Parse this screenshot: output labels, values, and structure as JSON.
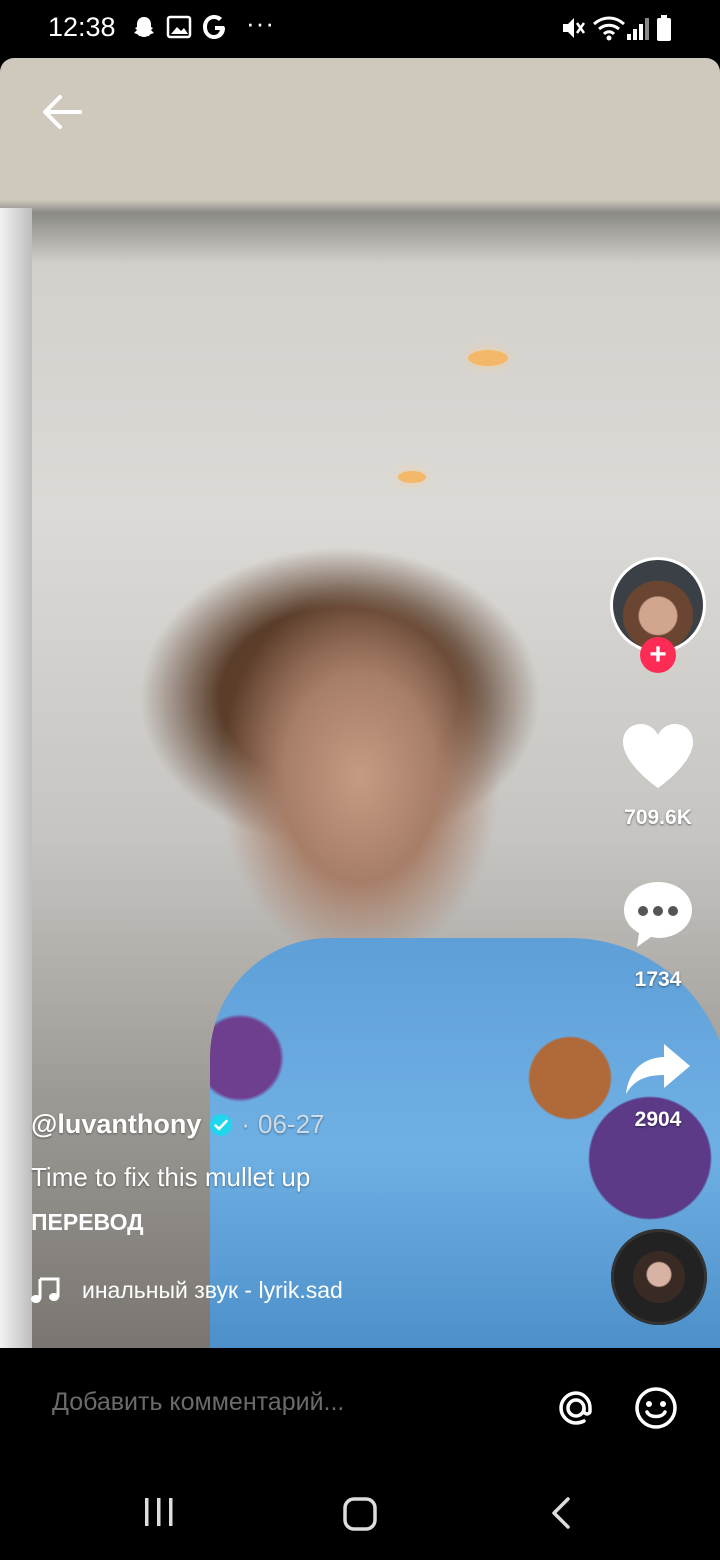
{
  "status_bar": {
    "time": "12:38",
    "more": "···"
  },
  "video": {
    "creator_handle": "@luvanthony",
    "date_separator": "·",
    "post_date": "06-27",
    "caption": "Time to fix this mullet up",
    "translate_label": "ПЕРЕВОД",
    "sound_label": "инальный звук - lyrik.sad"
  },
  "actions": {
    "likes": "709.6K",
    "comments": "1734",
    "shares": "2904",
    "follow_symbol": "+"
  },
  "comment_bar": {
    "placeholder": "Добавить комментарий..."
  },
  "colors": {
    "accent": "#fe2c55",
    "verified": "#20d5ec"
  }
}
